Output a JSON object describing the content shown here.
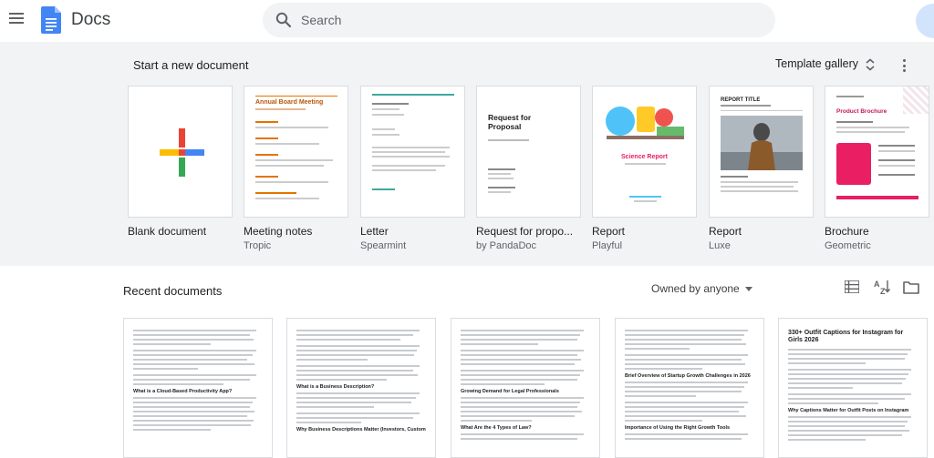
{
  "app": {
    "title": "Docs"
  },
  "search": {
    "placeholder": "Search"
  },
  "templates": {
    "heading": "Start a new document",
    "gallery_label": "Template gallery",
    "items": [
      {
        "name": "Blank document",
        "sub": ""
      },
      {
        "name": "Meeting notes",
        "sub": "Tropic",
        "thumb_heading": "Annual Board Meeting"
      },
      {
        "name": "Letter",
        "sub": "Spearmint"
      },
      {
        "name": "Request for propo...",
        "sub": "by PandaDoc",
        "thumb_heading": "Request for Proposal"
      },
      {
        "name": "Report",
        "sub": "Playful",
        "thumb_heading": "Science Report"
      },
      {
        "name": "Report",
        "sub": "Luxe",
        "thumb_heading": "REPORT TITLE"
      },
      {
        "name": "Brochure",
        "sub": "Geometric",
        "thumb_heading": "Product Brochure"
      }
    ]
  },
  "recent": {
    "heading": "Recent documents",
    "owner_filter": "Owned by anyone",
    "docs": [
      {
        "headings": [
          "What is a Cloud-Based Productivity App?"
        ]
      },
      {
        "headings": [
          "What is a Business Description?",
          "Why Business Descriptions Matter (Investors, Customers,"
        ]
      },
      {
        "headings": [
          "Growing Demand for Legal Professionals",
          "What Are the 4 Types of Law?"
        ]
      },
      {
        "headings": [
          "Brief Overview of Startup Growth Challenges in 2026",
          "Importance of Using the Right Growth Tools"
        ]
      },
      {
        "headings": [
          "330+ Outfit Captions for Instagram for Girls 2026",
          "Why Captions Matter for Outfit Posts on Instagram"
        ]
      }
    ]
  },
  "colors": {
    "docs_blue": "#4285f4",
    "plus_red": "#ea4335",
    "plus_yellow": "#fbbc04",
    "plus_green": "#34a853",
    "plus_blue": "#4285f4"
  }
}
